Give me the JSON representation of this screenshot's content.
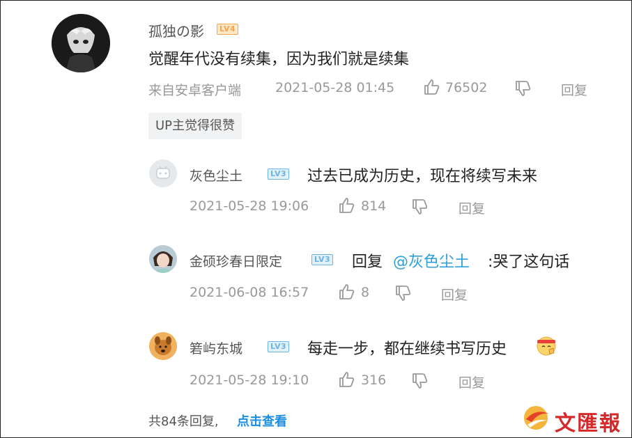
{
  "main_comment": {
    "username": "孤独の影",
    "level": "LV4",
    "content": "觉醒年代没有续集，因为我们就是续集",
    "source": "来自安卓客户端",
    "time": "2021-05-28 01:45",
    "likes": "76502",
    "reply_label": "回复",
    "up_tag": "UP主觉得很赞"
  },
  "replies": [
    {
      "username": "灰色尘土",
      "level": "LV3",
      "content": "过去已成为历史，现在将续写未来",
      "time": "2021-05-28 19:06",
      "likes": "814",
      "reply_label": "回复"
    },
    {
      "username": "金硕珍春日限定",
      "level": "LV3",
      "reply_prefix": "回复",
      "mention": "@灰色尘土",
      "content": ":哭了这句话",
      "time": "2021-06-08 16:57",
      "likes": "8",
      "reply_label": "回复"
    },
    {
      "username": "箬屿东城",
      "level": "LV3",
      "content": "每走一步，都在继续书写历史",
      "time": "2021-05-28 19:10",
      "likes": "316",
      "reply_label": "回复"
    }
  ],
  "footer": {
    "total_text": "共84条回复,",
    "view_link": "点击查看"
  },
  "watermark": {
    "text": "文匯報"
  },
  "colors": {
    "link": "#1b8ee3",
    "mention": "#2d9fdb",
    "meta": "#999999",
    "level4": "#f6a54a",
    "level3": "#6bb3e5",
    "watermark": "#d62a2a"
  }
}
